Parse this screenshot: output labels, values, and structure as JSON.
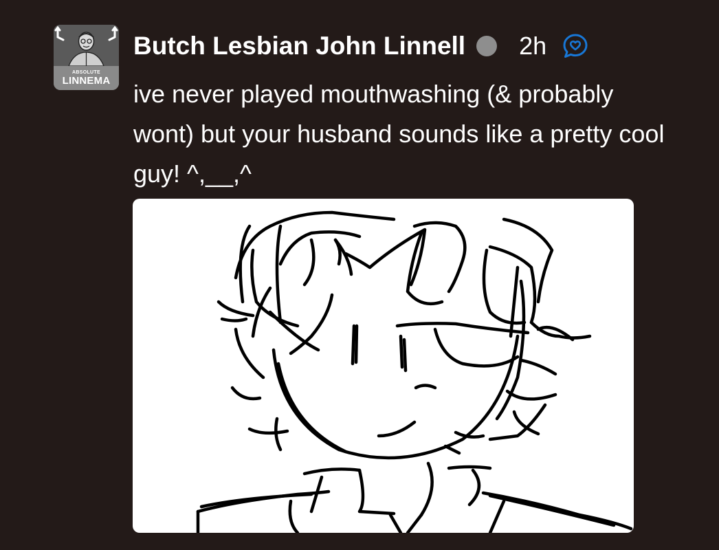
{
  "post": {
    "author": "Butch Lesbian John Linnell",
    "timestamp": "2h",
    "body": "ive never played mouthwashing (& probably wont) but your husband sounds like a pretty cool guy! ^,__,^",
    "avatar": {
      "small_text": "ABSOLUTE",
      "big_text": "LINNEMA"
    },
    "status_dot_color": "#8e8e8e",
    "reply_icon": "heart-speech-bubble-icon",
    "reply_icon_color": "#1877d6",
    "attachment": {
      "type": "drawing",
      "subject": "sketch of a smiling character with curly hair"
    }
  }
}
